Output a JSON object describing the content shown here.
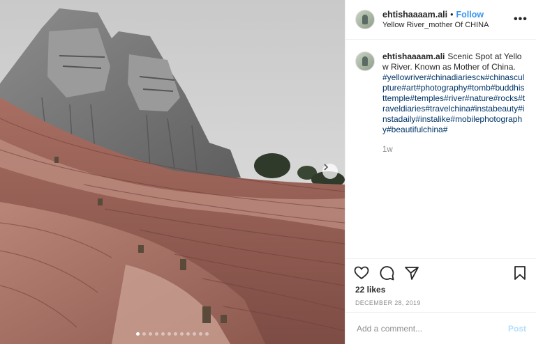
{
  "post": {
    "username": "ehtishaaaam.ali",
    "separator": "•",
    "follow_label": "Follow",
    "location": "Yellow River_mother Of CHINA",
    "more_icon": "more-options-icon",
    "more_label": "•••"
  },
  "caption": {
    "username": "ehtishaaaam.ali",
    "text": "Scenic Spot at Yellow River. Known as Mother of China.",
    "hashtags": "#yellowriver#chinadiariesᴄɴ#chinasculpture#art#photography#tomb#buddhisttemple#temples#river#nature#rocks#traveldiaries#travelchina#instabeauty#instadaily#instalike#mobilephotography#beautifulchina#",
    "time_ago": "1w"
  },
  "actions": {
    "like_icon": "heart-icon",
    "comment_icon": "comment-icon",
    "share_icon": "share-icon",
    "save_icon": "bookmark-icon"
  },
  "likes_text": "22 likes",
  "date_text": "DECEMBER 28, 2019",
  "comment": {
    "placeholder": "Add a comment...",
    "post_label": "Post"
  },
  "carousel": {
    "total_slides": 12,
    "active_slide": 1
  },
  "colors": {
    "accent": "#3897f0",
    "hashtag": "#003569",
    "muted": "#8e8e8e",
    "post_disabled": "#b2dffc"
  }
}
